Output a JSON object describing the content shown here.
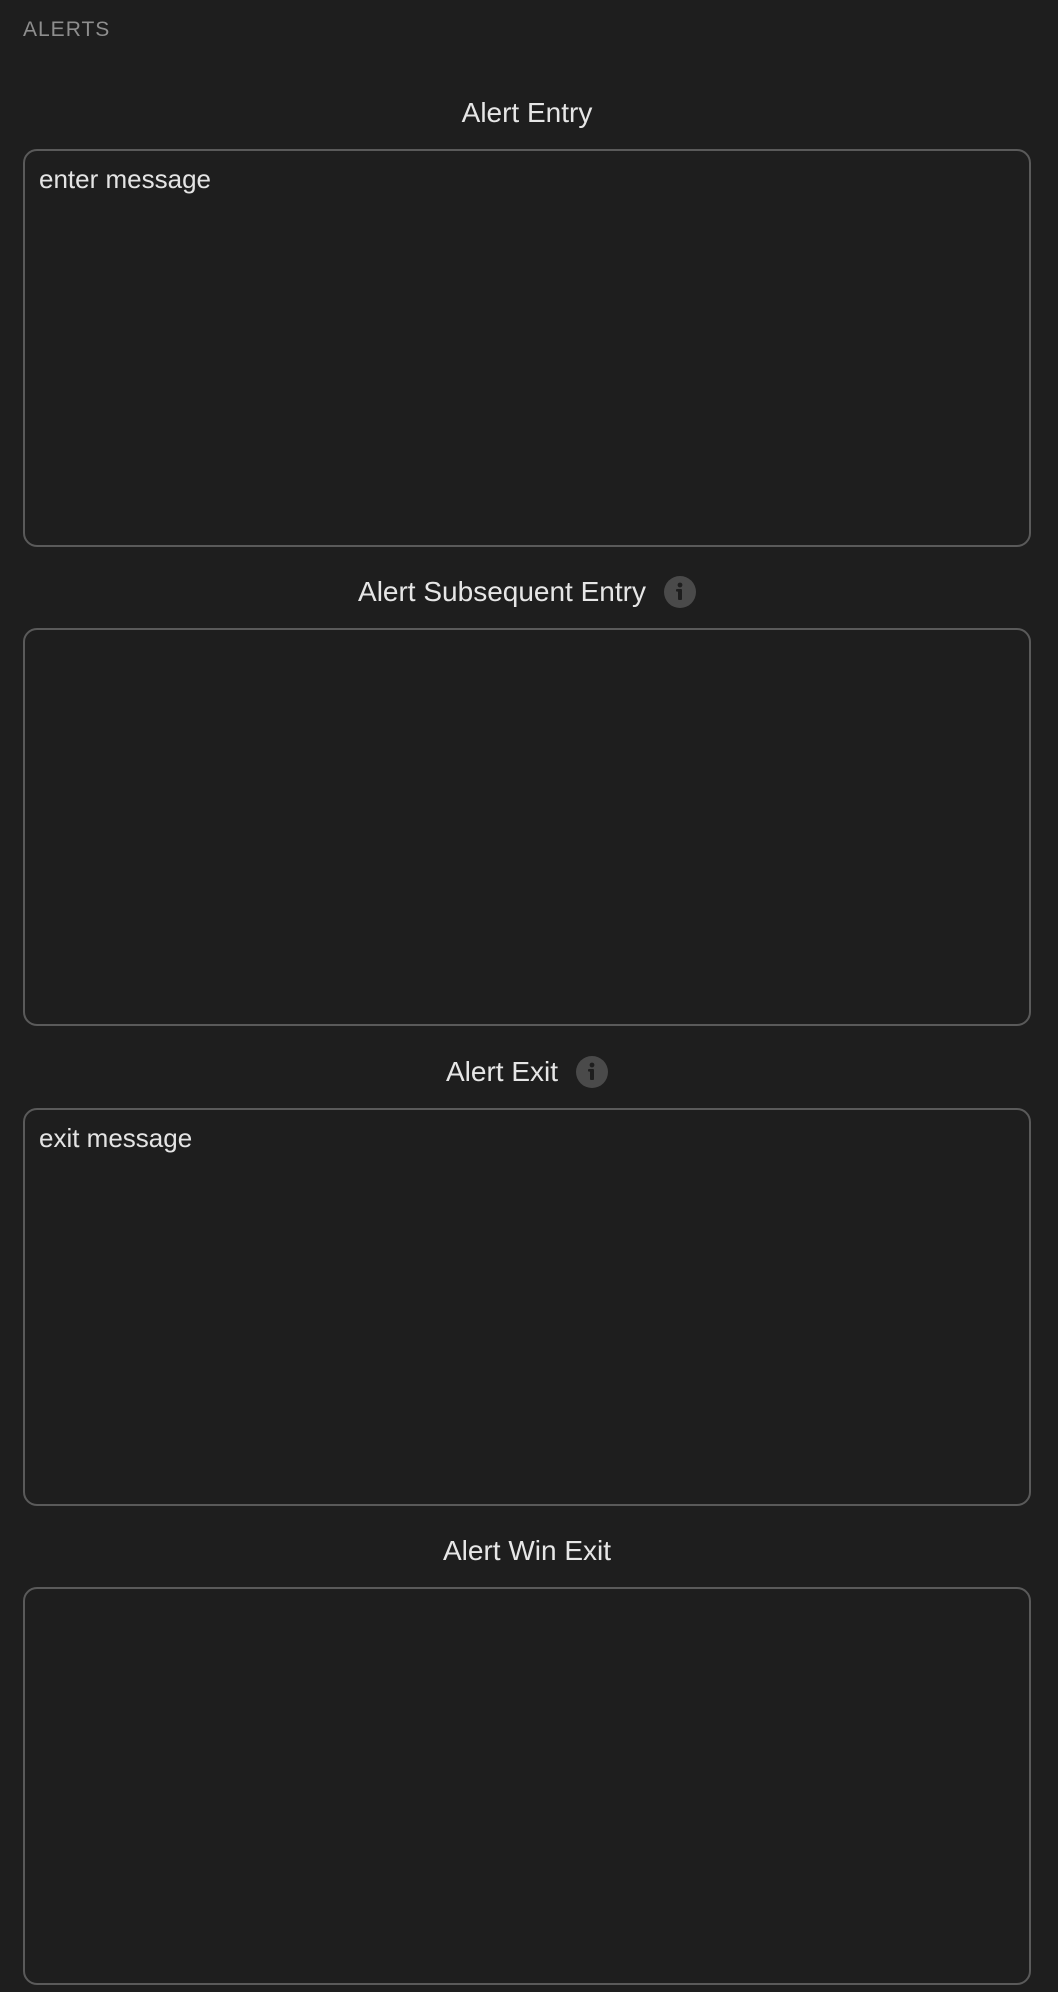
{
  "section": {
    "title": "ALERTS"
  },
  "fields": [
    {
      "label": "Alert Entry",
      "value": "enter message",
      "has_info": false
    },
    {
      "label": "Alert Subsequent Entry",
      "value": "",
      "has_info": true
    },
    {
      "label": "Alert Exit",
      "value": "exit message",
      "has_info": true
    },
    {
      "label": "Alert Win Exit",
      "value": "",
      "has_info": false
    }
  ],
  "icons": {
    "info": "info-icon"
  },
  "colors": {
    "background": "#1e1e1e",
    "border": "#5a5a5a",
    "header_text": "#8e8e8e",
    "label_text": "#e6e6e6",
    "info_icon_bg": "#4a4a4a"
  }
}
